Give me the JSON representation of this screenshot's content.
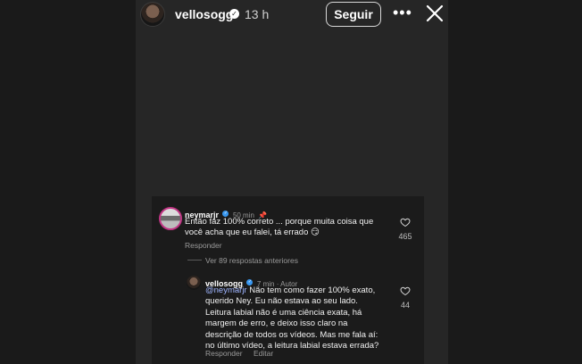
{
  "story": {
    "username": "vellosogg",
    "time": "13 h",
    "follow_label": "Seguir",
    "more_label": "•••",
    "close_icon": "close-icon"
  },
  "comments": {
    "first": {
      "username": "neymarjr",
      "meta": "50 min",
      "text": "Então faz 100% correto ... porque muita coisa que\nvocê acha que eu falei, tá errado 😏",
      "reply_label": "Responder",
      "likes": "465"
    },
    "view_previous": "Ver 89 respostas anteriores",
    "reply": {
      "username": "vellosogg",
      "meta": "7 min · Autor",
      "mention": "@neymarjr",
      "text": " Não tem como fazer 100% exato,\nquerido Ney. Eu não estava ao seu lado.\nLeitura labial não é uma ciência exata, há\nmargem de erro, e deixo isso claro na\ndescrição de todos os vídeos. Mas me fala aí:\nno último vídeo, a leitura labial estava errada?",
      "reply_label": "Responder",
      "edit_label": "Editar",
      "likes": "44"
    }
  },
  "colors": {
    "background": "#1f1f1f",
    "mention": "#9fb5ff",
    "verified": "#3897f0",
    "story_ring": "#c13584"
  }
}
